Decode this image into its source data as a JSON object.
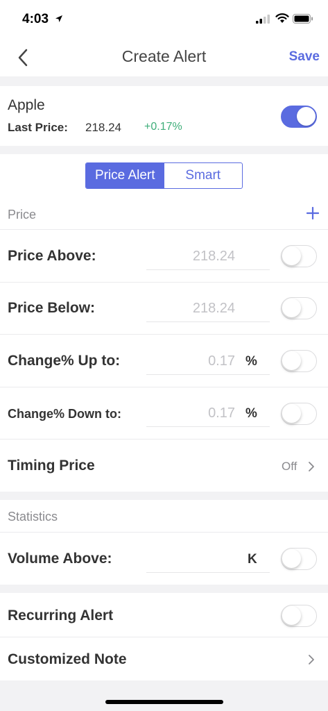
{
  "status_bar": {
    "time": "4:03"
  },
  "nav": {
    "title": "Create Alert",
    "save_label": "Save"
  },
  "stock": {
    "name": "Apple",
    "last_price_label": "Last Price:",
    "last_price": "218.24",
    "change": "+0.17%",
    "alert_enabled": true
  },
  "tabs": [
    {
      "label": "Price Alert",
      "active": true
    },
    {
      "label": "Smart",
      "active": false
    }
  ],
  "price_section": {
    "label": "Price",
    "rows": [
      {
        "label": "Price Above:",
        "value": "218.24",
        "unit": "",
        "enabled": false
      },
      {
        "label": "Price Below:",
        "value": "218.24",
        "unit": "",
        "enabled": false
      },
      {
        "label": "Change% Up to:",
        "value": "0.17",
        "unit": "%",
        "enabled": false
      },
      {
        "label": "Change% Down to:",
        "value": "0.17",
        "unit": "%",
        "enabled": false
      }
    ],
    "timing": {
      "label": "Timing Price",
      "value": "Off"
    }
  },
  "stats_section": {
    "label": "Statistics",
    "volume": {
      "label": "Volume Above:",
      "unit": "K",
      "enabled": false
    }
  },
  "recurring": {
    "label": "Recurring Alert",
    "enabled": false
  },
  "note": {
    "label": "Customized Note"
  },
  "colors": {
    "accent": "#5a6be0",
    "positive": "#3fae7a"
  }
}
